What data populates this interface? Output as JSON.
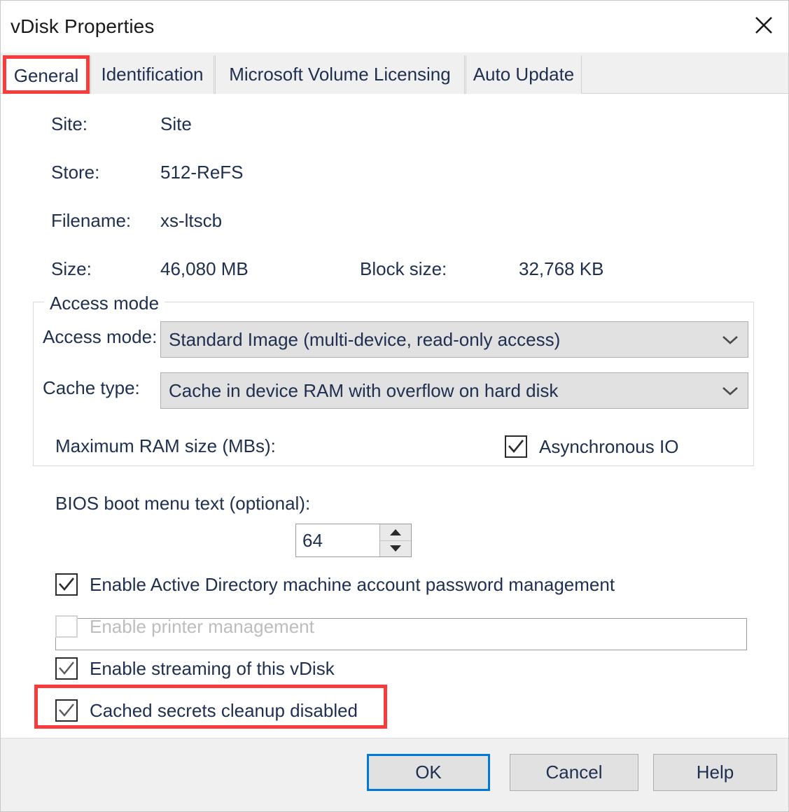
{
  "window": {
    "title": "vDisk Properties",
    "close_icon": "close-icon"
  },
  "tabs": [
    {
      "label": "General",
      "selected": true
    },
    {
      "label": "Identification",
      "selected": false
    },
    {
      "label": "Microsoft Volume Licensing",
      "selected": false
    },
    {
      "label": "Auto Update",
      "selected": false
    }
  ],
  "general": {
    "site_label": "Site:",
    "site_value": "Site",
    "store_label": "Store:",
    "store_value": "512-ReFS",
    "filename_label": "Filename:",
    "filename_value": "xs-ltscb",
    "size_label": "Size:",
    "size_value": "46,080 MB",
    "block_size_label": "Block size:",
    "block_size_value": "32,768 KB",
    "access_group": {
      "legend": "Access mode",
      "access_mode_label": "Access mode:",
      "access_mode_value": "Standard Image (multi-device, read-only access)",
      "cache_type_label": "Cache type:",
      "cache_type_value": "Cache in device RAM with overflow on hard disk",
      "max_ram_label": "Maximum RAM size (MBs):",
      "max_ram_value": "64",
      "async_io_label": "Asynchronous IO",
      "async_io_checked": true
    },
    "bios_label": "BIOS boot menu text (optional):",
    "bios_value": "",
    "bios_placeholder": "",
    "checkboxes": [
      {
        "label": "Enable Active Directory machine account password management",
        "checked": true,
        "disabled": false
      },
      {
        "label": "Enable printer management",
        "checked": false,
        "disabled": true
      },
      {
        "label": "Enable streaming of this vDisk",
        "checked": true,
        "disabled": false
      },
      {
        "label": "Cached secrets cleanup disabled",
        "checked": true,
        "disabled": false
      }
    ]
  },
  "footer": {
    "ok_label": "OK",
    "cancel_label": "Cancel",
    "help_label": "Help"
  },
  "annotations": {
    "color": "#f83c3c",
    "highlighted": [
      "General",
      "Cached secrets cleanup disabled"
    ]
  }
}
